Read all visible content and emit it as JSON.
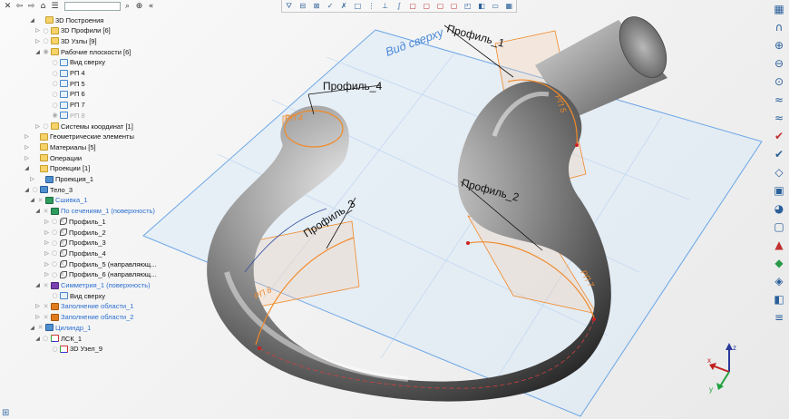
{
  "colors": {
    "tube_dark": "#3d3d3d",
    "tube_mid": "#9c9c9c",
    "tube_light": "#e8e8e8",
    "plane_blue": "#6aa6e6",
    "plane_fill": "#d4e6f9",
    "orange": "#f08a2a",
    "text_blue": "#2a6ed0"
  },
  "tree_toolbar": {
    "close_icon": "close-icon",
    "back_icon": "arrow-left-icon",
    "forward_icon": "arrow-right-icon",
    "home_icon": "home-icon",
    "list_icon": "list-icon",
    "search_value": "",
    "search_icon": "search-icon",
    "add_icon": "add-icon",
    "collapse_icon": "chevrons-left-icon"
  },
  "tree": [
    {
      "label": "3D Построения",
      "expander": "◢",
      "visible": "",
      "icon": "folder",
      "style": ""
    },
    {
      "label": "3D Профили [6]",
      "expander": "▷",
      "visible": "○",
      "icon": "folder",
      "style": ""
    },
    {
      "label": "3D Узлы [9]",
      "expander": "▷",
      "visible": "○",
      "icon": "folder",
      "style": ""
    },
    {
      "label": "Рабочие плоскости [6]",
      "expander": "◢",
      "visible": "◉",
      "icon": "folder",
      "style": ""
    },
    {
      "label": "Вид сверху",
      "expander": "",
      "visible": "○",
      "icon": "plane",
      "style": ""
    },
    {
      "label": "РП 4",
      "expander": "",
      "visible": "○",
      "icon": "plane",
      "style": ""
    },
    {
      "label": "РП 5",
      "expander": "",
      "visible": "○",
      "icon": "plane",
      "style": ""
    },
    {
      "label": "РП 6",
      "expander": "",
      "visible": "○",
      "icon": "plane",
      "style": ""
    },
    {
      "label": "РП 7",
      "expander": "",
      "visible": "○",
      "icon": "plane",
      "style": ""
    },
    {
      "label": "РП 8",
      "expander": "",
      "visible": "◉",
      "icon": "plane",
      "style": "dim"
    },
    {
      "label": "Системы координат [1]",
      "expander": "▷",
      "visible": "○",
      "icon": "folder",
      "style": ""
    },
    {
      "label": "Геометрические элементы",
      "expander": "▷",
      "visible": "",
      "icon": "folder",
      "style": ""
    },
    {
      "label": "Материалы [5]",
      "expander": "▷",
      "visible": "",
      "icon": "folder",
      "style": ""
    },
    {
      "label": "Операции",
      "expander": "▷",
      "visible": "",
      "icon": "folder",
      "style": ""
    },
    {
      "label": "Проекции [1]",
      "expander": "◢",
      "visible": "",
      "icon": "folder",
      "style": ""
    },
    {
      "label": "Проекция_1",
      "expander": "▷",
      "visible": "",
      "icon": "body",
      "style": ""
    },
    {
      "label": "Тело_3",
      "expander": "◢",
      "visible": "○",
      "icon": "body",
      "style": ""
    },
    {
      "label": "Сшивка_1",
      "expander": "◢",
      "visible": "✕",
      "icon": "surf",
      "style": "blue"
    },
    {
      "label": "По сечениям_1 (поверхность)",
      "expander": "◢",
      "visible": "✕",
      "icon": "surf",
      "style": "blue"
    },
    {
      "label": "Профиль_1",
      "expander": "▷",
      "visible": "○ ✕",
      "icon": "sketch",
      "style": ""
    },
    {
      "label": "Профиль_2",
      "expander": "▷",
      "visible": "○ ✕",
      "icon": "sketch",
      "style": ""
    },
    {
      "label": "Профиль_3",
      "expander": "▷",
      "visible": "○ ✕",
      "icon": "sketch",
      "style": ""
    },
    {
      "label": "Профиль_4",
      "expander": "▷",
      "visible": "○ ✕",
      "icon": "sketch",
      "style": ""
    },
    {
      "label": "Профиль_5 (направляющ...",
      "expander": "▷",
      "visible": "○ ✕",
      "icon": "sketch",
      "style": ""
    },
    {
      "label": "Профиль_6 (направляющ...",
      "expander": "▷",
      "visible": "○ ✕",
      "icon": "sketch",
      "style": ""
    },
    {
      "label": "Симметрия_1 (поверхность)",
      "expander": "◢",
      "visible": "✕",
      "icon": "mirror",
      "style": "blue"
    },
    {
      "label": "Вид сверху",
      "expander": "",
      "visible": "○",
      "icon": "plane",
      "style": ""
    },
    {
      "label": "Заполнение области_1",
      "expander": "▷",
      "visible": "✕",
      "icon": "fill",
      "style": "blue"
    },
    {
      "label": "Заполнение области_2",
      "expander": "▷",
      "visible": "✕",
      "icon": "fill",
      "style": "blue"
    },
    {
      "label": "Цилиндр_1",
      "expander": "◢",
      "visible": "✕",
      "icon": "body",
      "style": "blue"
    },
    {
      "label": "ЛСК_1",
      "expander": "◢",
      "visible": "○ ✕",
      "icon": "csys",
      "style": ""
    },
    {
      "label": "3D Узел_9",
      "expander": "",
      "visible": "○",
      "icon": "csys",
      "style": ""
    }
  ],
  "top_toolbar": [
    "filter-icon",
    "filter-plane-icon",
    "filter-edge-icon",
    "check-icon",
    "check-x-icon",
    "frame-icon",
    "point-icon",
    "axis-icon",
    "curve-icon",
    "face-red-icon",
    "face-red-2-icon",
    "face-red-3-icon",
    "face-red-4-icon",
    "solid-icon",
    "body-icon",
    "page-icon",
    "grid-icon"
  ],
  "right_toolbar": [
    "window-icon",
    "magnet-icon",
    "zoom-in-icon",
    "zoom-out-icon",
    "zoom-fit-icon",
    "measure-icon",
    "measure-2-icon",
    "check-red-icon",
    "check-blue-icon",
    "cube-outline-icon",
    "box-icon",
    "sphere-icon",
    "cube-icon",
    "cube-red-icon",
    "cube-green-icon",
    "slice-icon",
    "section-icon",
    "layers-icon"
  ],
  "right_glyphs": [
    "▦",
    "∩",
    "⊕",
    "⊖",
    "⊙",
    "≈",
    "≈",
    "✔",
    "✔",
    "◇",
    "▣",
    "◕",
    "▢",
    "▲",
    "◆",
    "◈",
    "◧",
    "≡"
  ],
  "viewport": {
    "plane_label": "Вид сверху",
    "profile_labels": [
      "Профиль_1",
      "Профиль_2",
      "Профиль_3",
      "Профиль_4"
    ],
    "rp_labels": [
      "РП 4",
      "РП 5",
      "РП 6",
      "РП 7"
    ]
  },
  "axis_triad": {
    "x": "x",
    "y": "y",
    "z": "z"
  },
  "bottom_left_icon": "split-view-icon"
}
